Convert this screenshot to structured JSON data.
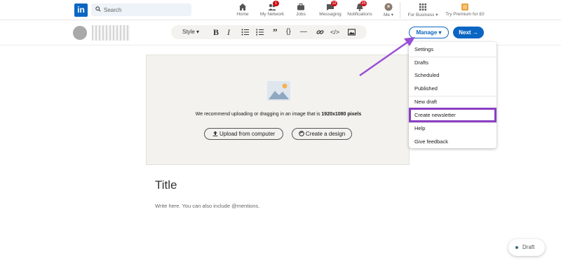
{
  "nav": {
    "logo": "in",
    "search_placeholder": "Search",
    "items": [
      {
        "label": "Home",
        "icon": "home-icon",
        "badge": ""
      },
      {
        "label": "My Network",
        "icon": "network-icon",
        "badge": "1"
      },
      {
        "label": "Jobs",
        "icon": "briefcase-icon",
        "badge": ""
      },
      {
        "label": "Messaging",
        "icon": "message-icon",
        "badge": "12"
      },
      {
        "label": "Notifications",
        "icon": "bell-icon",
        "badge": "25"
      },
      {
        "label": "Me ▾",
        "icon": "avatar-icon",
        "badge": ""
      },
      {
        "label": "For Business ▾",
        "icon": "grid-icon",
        "badge": ""
      },
      {
        "label": "Try Premium for £0",
        "icon": "premium-icon",
        "badge": ""
      }
    ]
  },
  "editor": {
    "style_label": "Style ▾",
    "manage_label": "Manage ▾",
    "next_label": "Next →"
  },
  "manage_menu": {
    "items": [
      "Settings",
      "Drafts",
      "Scheduled",
      "Published",
      "New draft",
      "Create newsletter",
      "Help",
      "Give feedback"
    ],
    "highlighted": "Create newsletter"
  },
  "upload": {
    "recommend_text": "We recommend uploading or dragging in an image that is ",
    "recommend_size": "1920x1080 pixels",
    "upload_label": "Upload from computer",
    "design_label": "Create a design"
  },
  "article": {
    "title_placeholder": "Title",
    "body_placeholder": "Write here. You can also include @mentions."
  },
  "status": {
    "draft_label": "Draft"
  },
  "colors": {
    "brand": "#0a66c2",
    "highlight": "#8a3fc4",
    "badge": "#cc1016"
  }
}
